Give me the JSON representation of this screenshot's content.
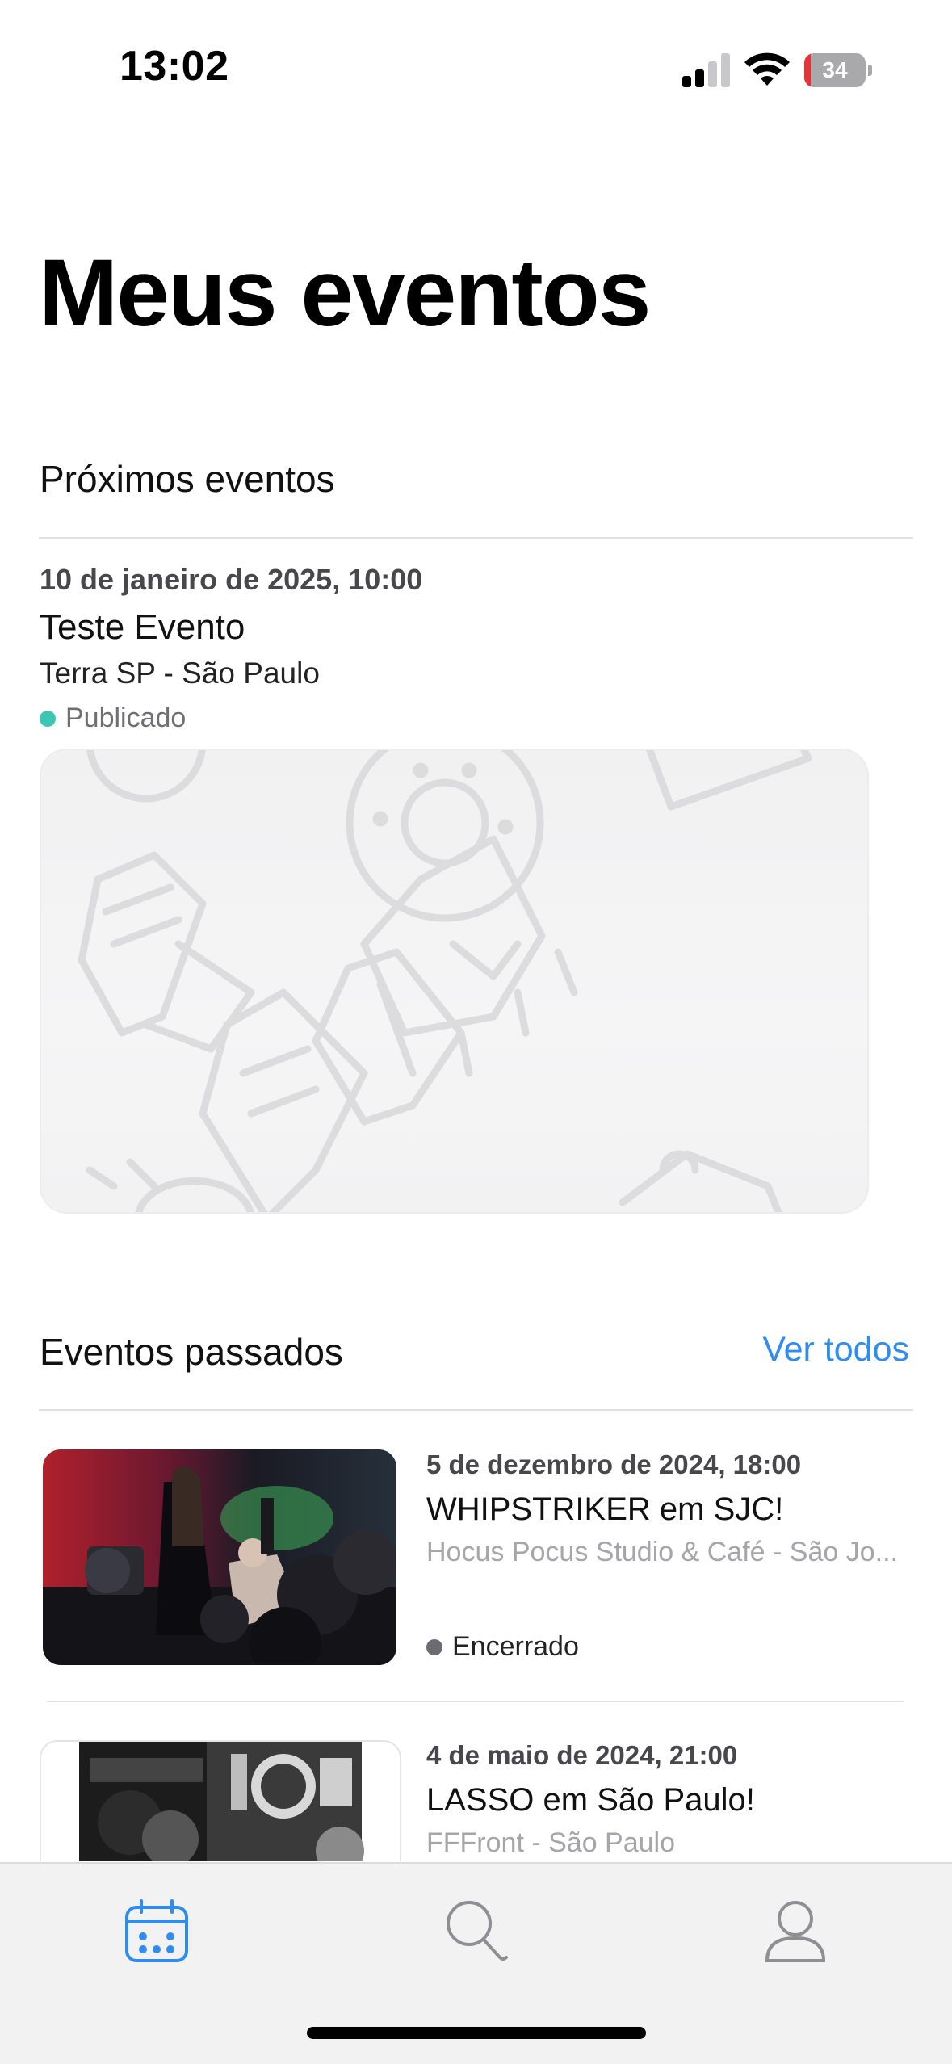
{
  "status_bar": {
    "time": "13:02",
    "battery": "34"
  },
  "header": {
    "title": "Meus eventos"
  },
  "upcoming": {
    "section_title": "Próximos eventos",
    "event": {
      "date": "10 de janeiro de 2025, 10:00",
      "name": "Teste Evento",
      "venue": "Terra SP - São Paulo",
      "status": "Publicado",
      "status_color": "#3cc7b4"
    }
  },
  "past": {
    "section_title": "Eventos passados",
    "see_all_label": "Ver todos",
    "events": [
      {
        "date": "5 de dezembro de 2024, 18:00",
        "name": "WHIPSTRIKER em SJC!",
        "venue": "Hocus Pocus Studio & Café - São Jo...",
        "status": "Encerrado",
        "status_color": "#6b6b72"
      },
      {
        "date": "4 de maio de 2024, 21:00",
        "name": "LASSO em São Paulo!",
        "venue": "FFFront - São Paulo"
      }
    ]
  },
  "tab_bar": {
    "tabs": [
      {
        "icon": "calendar-icon",
        "active": true
      },
      {
        "icon": "search-icon",
        "active": false
      },
      {
        "icon": "profile-icon",
        "active": false
      }
    ],
    "accent_color": "#2f8cf0"
  }
}
